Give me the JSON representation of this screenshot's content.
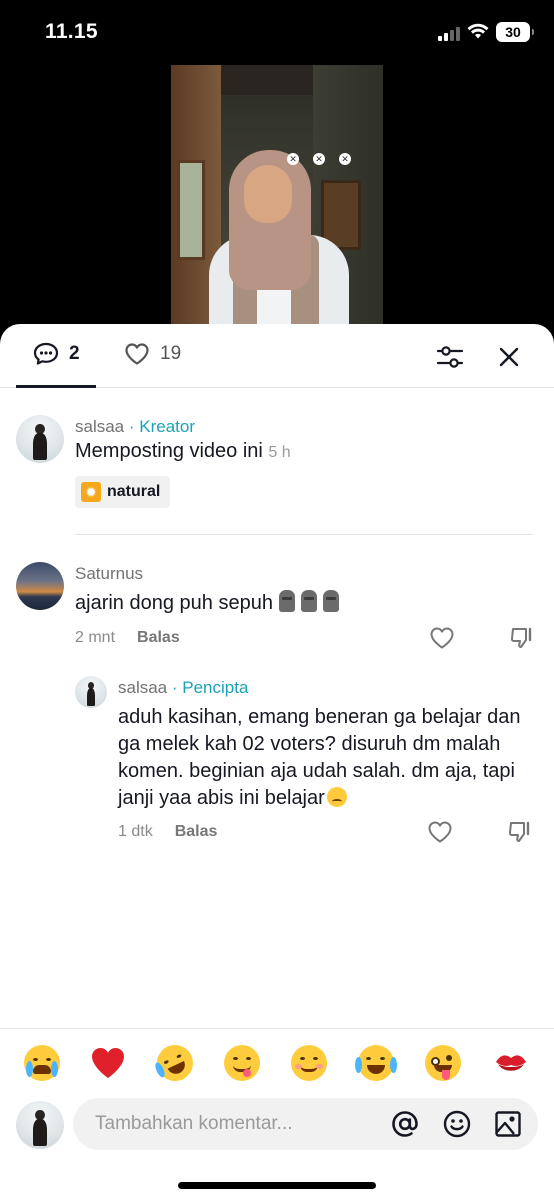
{
  "status_bar": {
    "time": "11.15",
    "battery": "30"
  },
  "tabs": {
    "comments_count": "2",
    "likes_count": "19"
  },
  "caption": {
    "username": "salsaa",
    "role": "· Kreator",
    "text": "Memposting video ini",
    "time": "5 h",
    "tag": "natural"
  },
  "comments": [
    {
      "username": "Saturnus",
      "text": "ajarin dong puh sepuh",
      "time": "2 mnt",
      "reply_label": "Balas"
    }
  ],
  "reply": {
    "username": "salsaa",
    "role": "· Pencipta",
    "line1": "aduh kasihan, emang beneran ga belajar dan",
    "line2": "ga melek kah 02 voters? disuruh dm malah",
    "line3": "komen. beginian aja udah salah. dm aja, tapi",
    "line4": "janji yaa abis ini belajar",
    "time": "1 dtk",
    "reply_label": "Balas"
  },
  "emoji_bar": [
    "loudly-crying-face",
    "red-heart",
    "rolling-on-floor-laughing",
    "face-savoring-food",
    "smiling-face",
    "tears-of-joy",
    "zany-face",
    "kiss-mark"
  ],
  "input": {
    "placeholder": "Tambahkan komentar..."
  },
  "icons": [
    "comment-icon",
    "heart-icon",
    "filter-icon",
    "close-icon",
    "like-icon",
    "dislike-icon",
    "at-icon",
    "emoji-icon",
    "image-icon"
  ],
  "colors": {
    "role_accent": "#1da1b7",
    "text": "#161823",
    "muted": "#8a8a8a"
  }
}
